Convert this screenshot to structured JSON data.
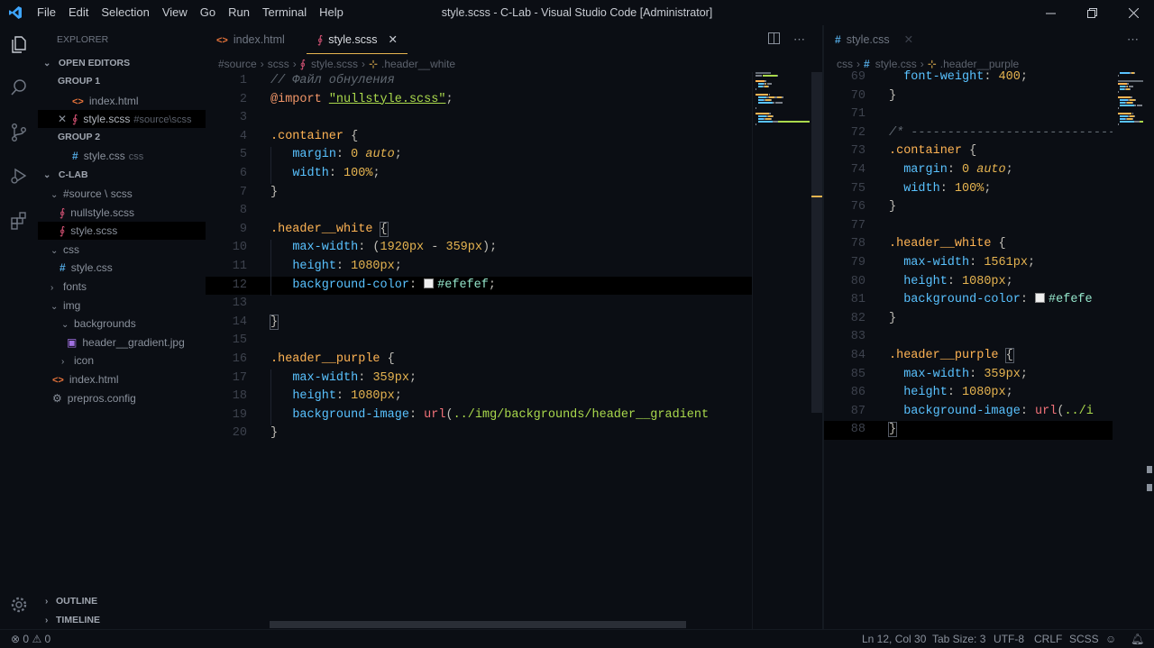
{
  "window": {
    "title": "style.scss - C-Lab - Visual Studio Code [Administrator]",
    "menu": [
      "File",
      "Edit",
      "Selection",
      "View",
      "Go",
      "Run",
      "Terminal",
      "Help"
    ]
  },
  "sidebar": {
    "title": "EXPLORER",
    "open_editors": "OPEN EDITORS",
    "group1": "GROUP 1",
    "g1_index": "index.html",
    "g1_style": "style.scss",
    "g1_style_desc": "#source\\scss",
    "group2": "GROUP 2",
    "g2_style": "style.css",
    "g2_style_desc": "css",
    "project": "C-LAB",
    "source_folder": "#source \\ scss",
    "nullstyle": "nullstyle.scss",
    "style_scss": "style.scss",
    "css_folder": "css",
    "style_css": "style.css",
    "fonts": "fonts",
    "img": "img",
    "backgrounds": "backgrounds",
    "header_gradient": "header__gradient.jpg",
    "icon": "icon",
    "index": "index.html",
    "prepros": "prepros.config",
    "outline": "OUTLINE",
    "timeline": "TIMELINE"
  },
  "left_editor": {
    "tabs": [
      "index.html",
      "style.scss"
    ],
    "breadcrumb": [
      "#source",
      "scss",
      "style.scss",
      ".header__white"
    ]
  },
  "right_editor": {
    "tab": "style.css",
    "breadcrumb": [
      "css",
      "style.css",
      ".header__purple"
    ]
  },
  "statusbar": {
    "problems": "0",
    "warnings": "0",
    "position": "Ln 12, Col 30",
    "tabsize": "Tab Size: 3",
    "encoding": "UTF-8",
    "eol": "CRLF",
    "language": "SCSS"
  },
  "colors": {
    "background": "#0b0e14",
    "accent": "#e6b450",
    "selector": "#ffb454",
    "property": "#59c2ff",
    "string": "#aad94c",
    "comment": "#626a73"
  },
  "code_left": [
    {
      "n": "1",
      "t": [
        [
          "// Файл обнуления",
          "t-cmt"
        ]
      ]
    },
    {
      "n": "2",
      "t": [
        [
          "@import",
          "t-at"
        ],
        [
          " ",
          ""
        ],
        [
          "\"nullstyle.scss\"",
          "t-str"
        ],
        [
          ";",
          "t-punc"
        ]
      ]
    },
    {
      "n": "3",
      "t": []
    },
    {
      "n": "4",
      "t": [
        [
          ".container",
          "t-sel"
        ],
        [
          " {",
          "t-punc"
        ]
      ]
    },
    {
      "n": "5",
      "t": [
        [
          "   ",
          ""
        ],
        [
          "margin",
          "t-prop"
        ],
        [
          ": ",
          "t-punc"
        ],
        [
          "0",
          "t-num"
        ],
        [
          " ",
          ""
        ],
        [
          "auto",
          "t-kw"
        ],
        [
          ";",
          "t-punc"
        ]
      ]
    },
    {
      "n": "6",
      "t": [
        [
          "   ",
          ""
        ],
        [
          "width",
          "t-prop"
        ],
        [
          ": ",
          "t-punc"
        ],
        [
          "100%",
          "t-num"
        ],
        [
          ";",
          "t-punc"
        ]
      ]
    },
    {
      "n": "7",
      "t": [
        [
          "}",
          "t-punc"
        ]
      ]
    },
    {
      "n": "8",
      "t": []
    },
    {
      "n": "9",
      "t": [
        [
          ".header__white",
          "t-sel"
        ],
        [
          " ",
          ""
        ],
        [
          "{",
          "t-punc brk"
        ]
      ]
    },
    {
      "n": "10",
      "t": [
        [
          "   ",
          ""
        ],
        [
          "max-width",
          "t-prop"
        ],
        [
          ": (",
          "t-punc"
        ],
        [
          "1920px",
          "t-num"
        ],
        [
          " - ",
          "t-punc"
        ],
        [
          "359px",
          "t-num"
        ],
        [
          ");",
          "t-punc"
        ]
      ]
    },
    {
      "n": "11",
      "t": [
        [
          "   ",
          ""
        ],
        [
          "height",
          "t-prop"
        ],
        [
          ": ",
          "t-punc"
        ],
        [
          "1080px",
          "t-num"
        ],
        [
          ";",
          "t-punc"
        ]
      ]
    },
    {
      "n": "12",
      "cur": true,
      "t": [
        [
          "   ",
          ""
        ],
        [
          "background-color",
          "t-prop"
        ],
        [
          ": ",
          "t-punc"
        ],
        [
          "SWATCH",
          "swatch"
        ],
        [
          "#efefef",
          "t-col"
        ],
        [
          ";",
          "t-punc"
        ]
      ]
    },
    {
      "n": "13",
      "t": []
    },
    {
      "n": "14",
      "t": [
        [
          "}",
          "t-punc brk"
        ]
      ]
    },
    {
      "n": "15",
      "t": []
    },
    {
      "n": "16",
      "t": [
        [
          ".header__purple",
          "t-sel"
        ],
        [
          " {",
          "t-punc"
        ]
      ]
    },
    {
      "n": "17",
      "t": [
        [
          "   ",
          ""
        ],
        [
          "max-width",
          "t-prop"
        ],
        [
          ": ",
          "t-punc"
        ],
        [
          "359px",
          "t-num"
        ],
        [
          ";",
          "t-punc"
        ]
      ]
    },
    {
      "n": "18",
      "t": [
        [
          "   ",
          ""
        ],
        [
          "height",
          "t-prop"
        ],
        [
          ": ",
          "t-punc"
        ],
        [
          "1080px",
          "t-num"
        ],
        [
          ";",
          "t-punc"
        ]
      ]
    },
    {
      "n": "19",
      "t": [
        [
          "   ",
          ""
        ],
        [
          "background-image",
          "t-prop"
        ],
        [
          ": ",
          "t-punc"
        ],
        [
          "url",
          "t-fn"
        ],
        [
          "(",
          "t-punc"
        ],
        [
          "../img/backgrounds/header__gradient",
          "t-urlp"
        ]
      ]
    },
    {
      "n": "20",
      "t": [
        [
          "}",
          "t-punc"
        ]
      ]
    }
  ],
  "code_right": [
    {
      "n": "69",
      "t": [
        [
          "  ",
          ""
        ],
        [
          "font-weight",
          "t-prop"
        ],
        [
          ": ",
          "t-punc"
        ],
        [
          "400",
          "t-num"
        ],
        [
          ";",
          "t-punc"
        ]
      ]
    },
    {
      "n": "70",
      "t": [
        [
          "}",
          "t-punc"
        ]
      ]
    },
    {
      "n": "71",
      "t": []
    },
    {
      "n": "72",
      "t": [
        [
          "/* -------------------------------------",
          "t-cmt"
        ]
      ]
    },
    {
      "n": "73",
      "t": [
        [
          ".container",
          "t-sel"
        ],
        [
          " {",
          "t-punc"
        ]
      ]
    },
    {
      "n": "74",
      "t": [
        [
          "  ",
          ""
        ],
        [
          "margin",
          "t-prop"
        ],
        [
          ": ",
          "t-punc"
        ],
        [
          "0",
          "t-num"
        ],
        [
          " ",
          ""
        ],
        [
          "auto",
          "t-kw"
        ],
        [
          ";",
          "t-punc"
        ]
      ]
    },
    {
      "n": "75",
      "t": [
        [
          "  ",
          ""
        ],
        [
          "width",
          "t-prop"
        ],
        [
          ": ",
          "t-punc"
        ],
        [
          "100%",
          "t-num"
        ],
        [
          ";",
          "t-punc"
        ]
      ]
    },
    {
      "n": "76",
      "t": [
        [
          "}",
          "t-punc"
        ]
      ]
    },
    {
      "n": "77",
      "t": []
    },
    {
      "n": "78",
      "t": [
        [
          ".header__white",
          "t-sel"
        ],
        [
          " {",
          "t-punc"
        ]
      ]
    },
    {
      "n": "79",
      "t": [
        [
          "  ",
          ""
        ],
        [
          "max-width",
          "t-prop"
        ],
        [
          ": ",
          "t-punc"
        ],
        [
          "1561px",
          "t-num"
        ],
        [
          ";",
          "t-punc"
        ]
      ]
    },
    {
      "n": "80",
      "t": [
        [
          "  ",
          ""
        ],
        [
          "height",
          "t-prop"
        ],
        [
          ": ",
          "t-punc"
        ],
        [
          "1080px",
          "t-num"
        ],
        [
          ";",
          "t-punc"
        ]
      ]
    },
    {
      "n": "81",
      "t": [
        [
          "  ",
          ""
        ],
        [
          "background-color",
          "t-prop"
        ],
        [
          ": ",
          "t-punc"
        ],
        [
          "SWATCH",
          "swatch"
        ],
        [
          "#efefe",
          "t-col"
        ]
      ]
    },
    {
      "n": "82",
      "t": [
        [
          "}",
          "t-punc"
        ]
      ]
    },
    {
      "n": "83",
      "t": []
    },
    {
      "n": "84",
      "t": [
        [
          ".header__purple",
          "t-sel"
        ],
        [
          " ",
          ""
        ],
        [
          "{",
          "t-punc brk"
        ]
      ]
    },
    {
      "n": "85",
      "t": [
        [
          "  ",
          ""
        ],
        [
          "max-width",
          "t-prop"
        ],
        [
          ": ",
          "t-punc"
        ],
        [
          "359px",
          "t-num"
        ],
        [
          ";",
          "t-punc"
        ]
      ]
    },
    {
      "n": "86",
      "t": [
        [
          "  ",
          ""
        ],
        [
          "height",
          "t-prop"
        ],
        [
          ": ",
          "t-punc"
        ],
        [
          "1080px",
          "t-num"
        ],
        [
          ";",
          "t-punc"
        ]
      ]
    },
    {
      "n": "87",
      "t": [
        [
          "  ",
          ""
        ],
        [
          "background-image",
          "t-prop"
        ],
        [
          ": ",
          "t-punc"
        ],
        [
          "url",
          "t-fn"
        ],
        [
          "(",
          "t-punc"
        ],
        [
          "../i",
          "t-urlp"
        ]
      ]
    },
    {
      "n": "88",
      "cur": true,
      "t": [
        [
          "}",
          "t-punc brk"
        ]
      ]
    }
  ]
}
